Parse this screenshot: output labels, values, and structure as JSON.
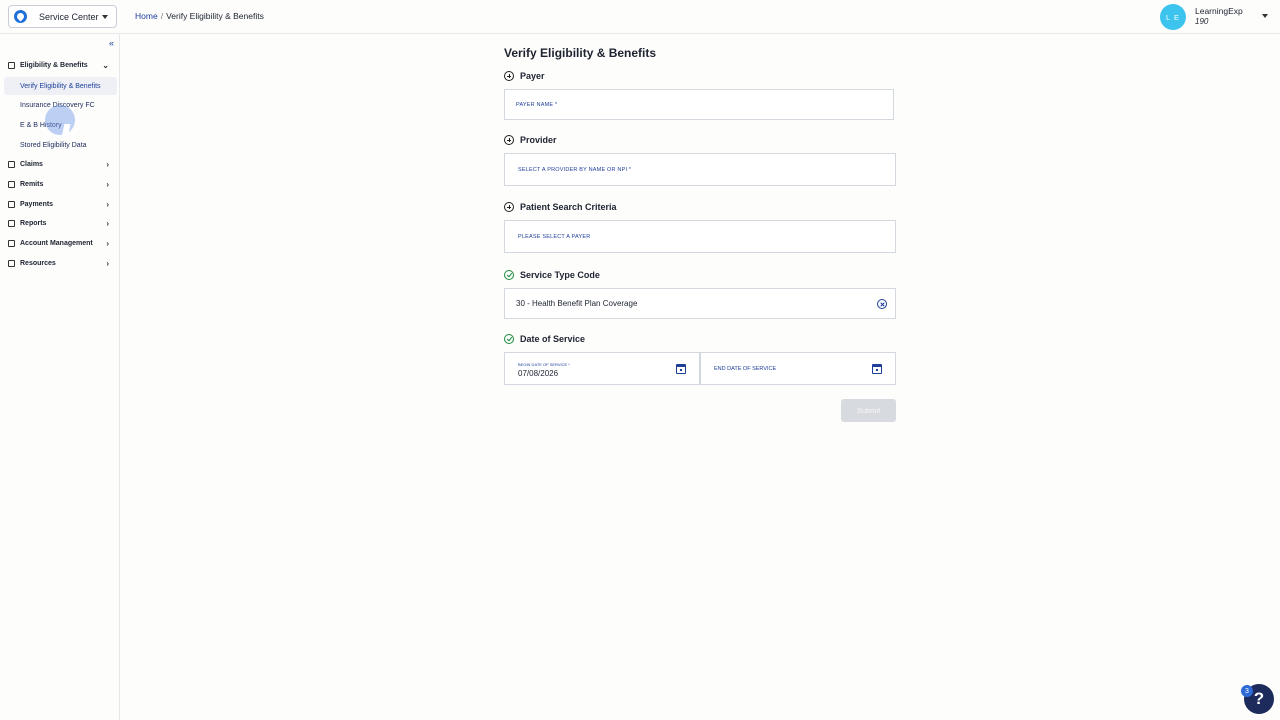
{
  "app": {
    "service_selector": "Service Center"
  },
  "breadcrumb": {
    "home": "Home",
    "separator": "/",
    "current": "Verify Eligibility & Benefits"
  },
  "user": {
    "initials": "L E",
    "name": "LearningExp",
    "id": "190"
  },
  "sidebar": {
    "collapse_glyph": "«",
    "groups": [
      {
        "label": "Eligibility & Benefits",
        "icon": "eligibility-icon",
        "expanded": true
      },
      {
        "label": "Claims",
        "icon": "claims-icon"
      },
      {
        "label": "Remits",
        "icon": "remits-icon"
      },
      {
        "label": "Payments",
        "icon": "payments-icon"
      },
      {
        "label": "Reports",
        "icon": "reports-icon"
      },
      {
        "label": "Account Management",
        "icon": "account-icon"
      },
      {
        "label": "Resources",
        "icon": "resources-icon"
      }
    ],
    "sub_items": [
      {
        "label": "Verify Eligibility & Benefits",
        "active": true
      },
      {
        "label": "Insurance Discovery FC"
      },
      {
        "label": "E & B History"
      },
      {
        "label": "Stored Eligibility Data"
      }
    ]
  },
  "main": {
    "title": "Verify Eligibility & Benefits",
    "payer": {
      "heading": "Payer",
      "placeholder": "PAYER NAME *"
    },
    "provider": {
      "heading": "Provider",
      "placeholder": "SELECT A PROVIDER BY NAME OR NPI *"
    },
    "patient": {
      "heading": "Patient Search Criteria",
      "placeholder": "PLEASE SELECT A PAYER"
    },
    "service_type": {
      "heading": "Service Type Code",
      "value": "30 - Health Benefit Plan Coverage"
    },
    "date_of_service": {
      "heading": "Date of Service",
      "begin_label": "BEGIN DATE OF SERVICE *",
      "begin_value": "07/08/2026",
      "end_placeholder": "END DATE OF SERVICE"
    },
    "submit_label": "Submit"
  },
  "help": {
    "glyph": "?",
    "badge_count": "3"
  },
  "colors": {
    "accent": "#1d3f9a",
    "success": "#1a8a3c",
    "avatar": "#3cc4ef",
    "help_bg": "#1d2a5c"
  }
}
